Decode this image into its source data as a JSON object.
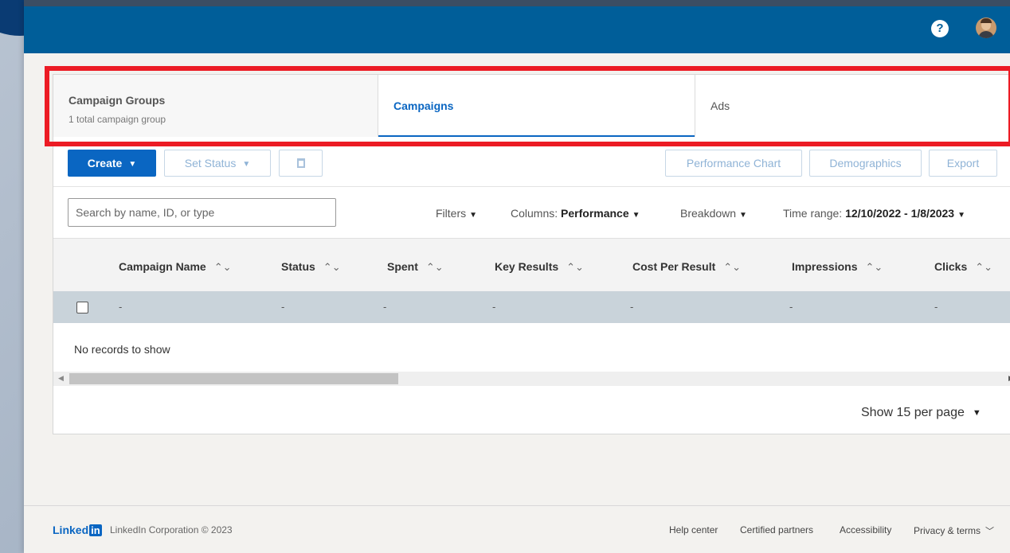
{
  "header": {
    "help_icon_glyph": "?"
  },
  "tabs": [
    {
      "title": "Campaign Groups",
      "subtitle": "1 total campaign group"
    },
    {
      "title": "Campaigns"
    },
    {
      "title": "Ads"
    }
  ],
  "toolbar": {
    "create_label": "Create",
    "set_status_label": "Set Status",
    "performance_chart_label": "Performance Chart",
    "demographics_label": "Demographics",
    "export_label": "Export"
  },
  "filters": {
    "search_placeholder": "Search by name, ID, or type",
    "filters_label": "Filters",
    "columns_label": "Columns:",
    "columns_value": "Performance",
    "breakdown_label": "Breakdown",
    "time_range_label": "Time range:",
    "time_range_value": "12/10/2022 - 1/8/2023"
  },
  "table": {
    "columns": [
      "Campaign Name",
      "Status",
      "Spent",
      "Key Results",
      "Cost Per Result",
      "Impressions",
      "Clicks"
    ],
    "row_placeholder": "-",
    "empty_message": "No records to show"
  },
  "pagination": {
    "label": "Show 15 per page"
  },
  "footer": {
    "logo_text": "Linked",
    "logo_in": "in",
    "copyright": "LinkedIn Corporation © 2023",
    "links": [
      "Help center",
      "Certified partners",
      "Accessibility",
      "Privacy & terms"
    ]
  },
  "colors": {
    "topbar": "#005e99",
    "accent": "#0a66c2",
    "highlight": "#ec1b24"
  },
  "icons": [
    "help-icon",
    "avatar",
    "dropdown-caret-icon",
    "trash-icon",
    "sort-icon",
    "scroll-arrow-icon",
    "chevron-down-icon"
  ]
}
